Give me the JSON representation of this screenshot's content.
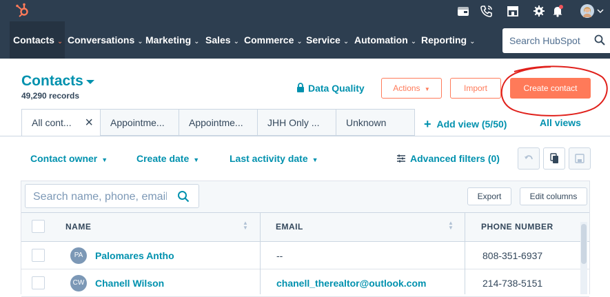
{
  "topbar": {
    "icons": [
      "hubspot-sprocket-logo",
      "marketplace-icon",
      "calling-icon",
      "marketplace-store-icon",
      "settings-gear-icon",
      "notifications-bell-icon",
      "user-avatar"
    ]
  },
  "nav": {
    "items": [
      {
        "label": "Contacts"
      },
      {
        "label": "Conversations"
      },
      {
        "label": "Marketing"
      },
      {
        "label": "Sales"
      },
      {
        "label": "Commerce"
      },
      {
        "label": "Service"
      },
      {
        "label": "Automation"
      },
      {
        "label": "Reporting"
      }
    ],
    "search_placeholder": "Search HubSpot"
  },
  "header": {
    "title": "Contacts",
    "records": "49,290 records",
    "data_quality": "Data Quality",
    "actions_label": "Actions",
    "import_label": "Import",
    "create_label": "Create contact"
  },
  "tabs": [
    {
      "label": "All cont..."
    },
    {
      "label": "Appointme..."
    },
    {
      "label": "Appointme..."
    },
    {
      "label": "JHH Only ..."
    },
    {
      "label": "Unknown"
    }
  ],
  "views": {
    "add_view": "Add view (5/50)",
    "all_views": "All views"
  },
  "filters": {
    "contact_owner": "Contact owner",
    "create_date": "Create date",
    "last_activity": "Last activity date",
    "advanced": "Advanced filters (0)"
  },
  "table": {
    "search_placeholder": "Search name, phone, email",
    "export_label": "Export",
    "edit_columns_label": "Edit columns",
    "columns": [
      "NAME",
      "EMAIL",
      "PHONE NUMBER"
    ],
    "rows": [
      {
        "initials": "PA",
        "name": "Palomares Antho",
        "email": "--",
        "phone": "808-351-6937"
      },
      {
        "initials": "CW",
        "name": "Chanell Wilson",
        "email": "chanell_therealtor@outlook.com",
        "phone": "214-738-5151"
      }
    ]
  },
  "colors": {
    "nav_bg": "#2d3e50",
    "accent_orange": "#ff7a59",
    "link_teal": "#0091ae",
    "annotation_red": "#e0201b"
  }
}
